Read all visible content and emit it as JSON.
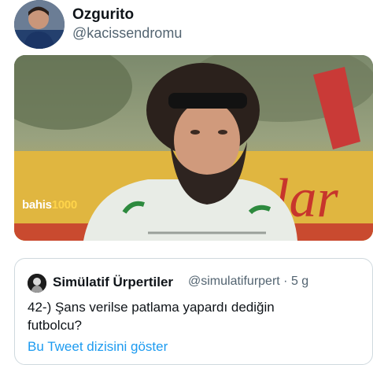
{
  "author": {
    "display_name": "Ozgurito",
    "handle": "@kacissendromu",
    "avatar_icon": "user-avatar-icon"
  },
  "media": {
    "watermark_text": "bahis",
    "watermark_accent": "1000",
    "accent_color": "#ffd44a"
  },
  "quoted_tweet": {
    "display_name": "Simülatif Ürpertiler",
    "handle_and_time": "@simulatifurpert · 5 g",
    "text": "42-) Şans verilse patlama yapardı dediğin futbolcu?",
    "thread_link": "Bu Tweet dizisini göster",
    "link_color": "#1d9bf0"
  }
}
